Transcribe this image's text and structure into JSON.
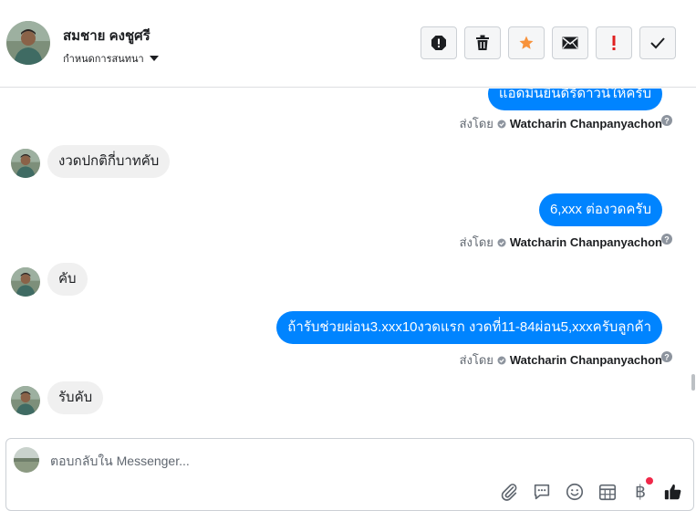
{
  "header": {
    "contact_name": "สมชาย คงชูศรี",
    "assign_label": "กำหนดการสนทนา",
    "actions": [
      "spam",
      "delete",
      "star",
      "mark-unread",
      "important",
      "done"
    ],
    "star_color": "#f7923b",
    "important_color": "#e02020"
  },
  "thread": {
    "messages": [
      {
        "dir": "out",
        "text": "แอดมินยินดีรีดาวน์ให้ครับ"
      },
      {
        "dir": "in",
        "text": "งวดปกติกี่บาทคับ"
      },
      {
        "dir": "out",
        "text": "6,xxx ต่องวดครับ"
      },
      {
        "dir": "in",
        "text": "คับ"
      },
      {
        "dir": "out",
        "text": "ถ้ารับช่วยผ่อน3.xxx10งวดแรก งวดที่11-84ผ่อน5,xxxครับลูกค้า"
      },
      {
        "dir": "in",
        "text": "รับคับ"
      }
    ],
    "sent_by_label": "ส่งโดย",
    "agent_name": "Watcharin Chanpanyachon"
  },
  "composer": {
    "placeholder": "ตอบกลับใน Messenger...",
    "tools": [
      "attachment-icon",
      "chat-icon",
      "emoji-icon",
      "table-icon",
      "baht-icon",
      "like-icon"
    ],
    "baht_symbol": "฿"
  },
  "colors": {
    "outgoing_bubble": "#0084ff",
    "incoming_bubble": "#f0f0f0",
    "notification_dot": "#f02849"
  }
}
